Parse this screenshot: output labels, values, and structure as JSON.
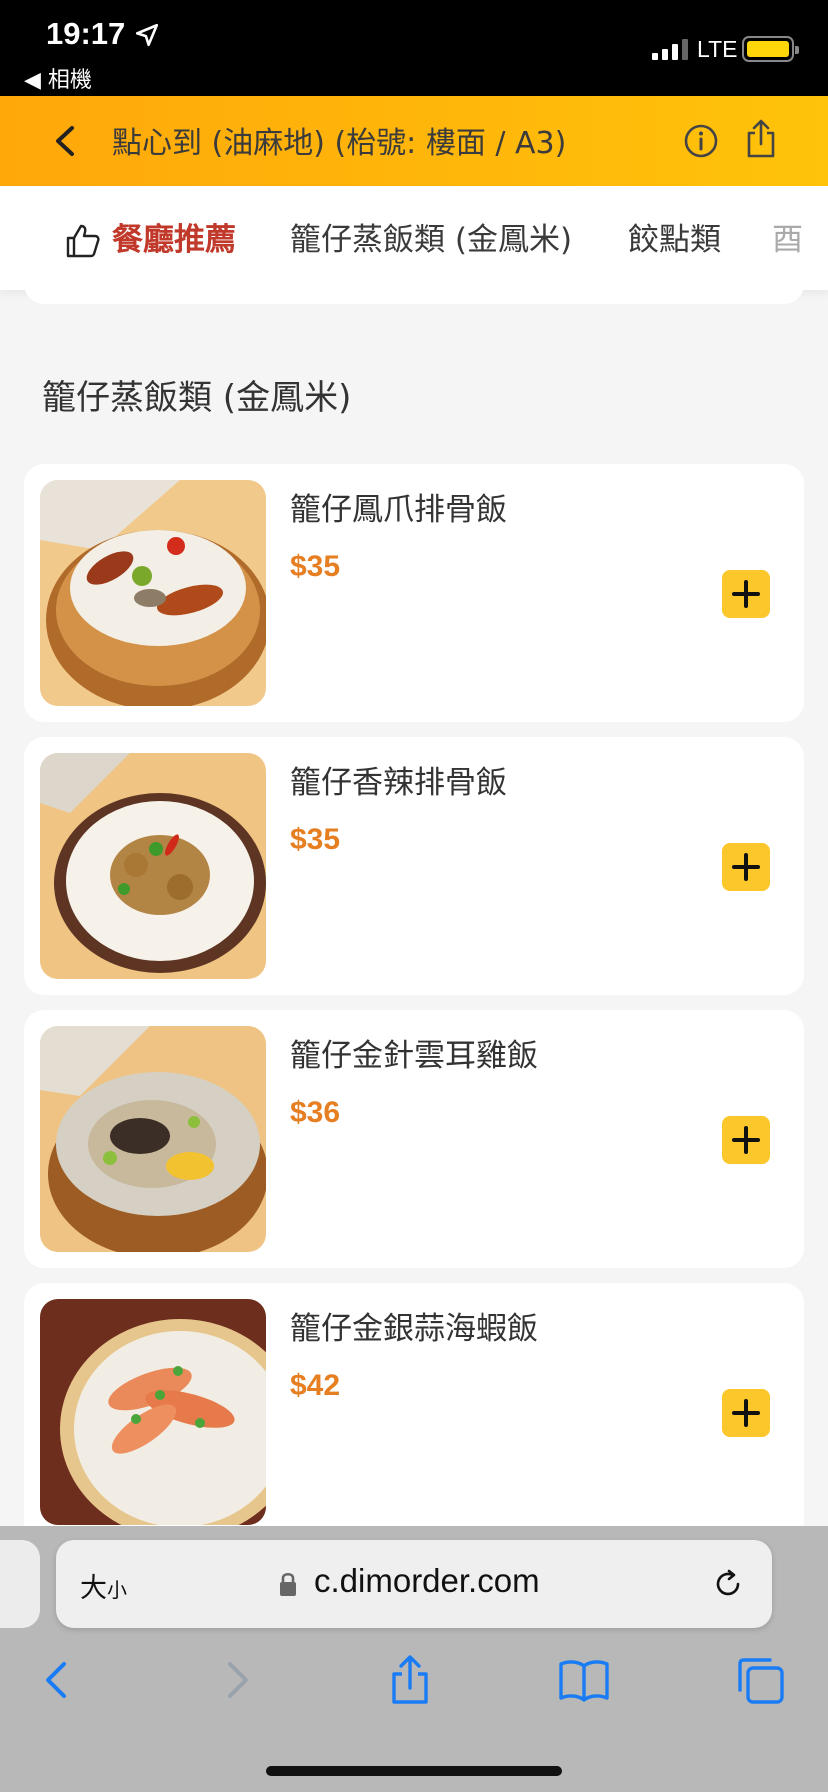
{
  "status_bar": {
    "time": "19:17",
    "back_app": "◀ 相機",
    "network": "LTE"
  },
  "header": {
    "title": "點心到 (油麻地) (枱號: 樓面 / A3)"
  },
  "tabs": [
    {
      "label": "餐廳推薦",
      "active": true
    },
    {
      "label": "籠仔蒸飯類 (金鳳米)",
      "active": false
    },
    {
      "label": "餃點類",
      "active": false
    },
    {
      "label": "酉",
      "active": false
    }
  ],
  "section": {
    "title": "籠仔蒸飯類 (金鳳米)"
  },
  "items": [
    {
      "name": "籠仔鳳爪排骨飯",
      "price": "$35",
      "image": "phoenix-claw-rice-photo"
    },
    {
      "name": "籠仔香辣排骨飯",
      "price": "$35",
      "image": "spicy-pork-rib-rice-photo"
    },
    {
      "name": "籠仔金針雲耳雞飯",
      "price": "$36",
      "image": "chicken-fungus-rice-photo"
    },
    {
      "name": "籠仔金銀蒜海蝦飯",
      "price": "$42",
      "image": "garlic-shrimp-rice-photo"
    }
  ],
  "browser": {
    "text_size_label": "大",
    "text_size_small": "小",
    "url": "c.dimorder.com"
  },
  "colors": {
    "header_start": "#ffa80a",
    "header_end": "#ffc30a",
    "active_tab": "#c0392b",
    "price": "#e67e22",
    "add_button": "#fcc72b",
    "ios_blue": "#1a7cf5"
  }
}
